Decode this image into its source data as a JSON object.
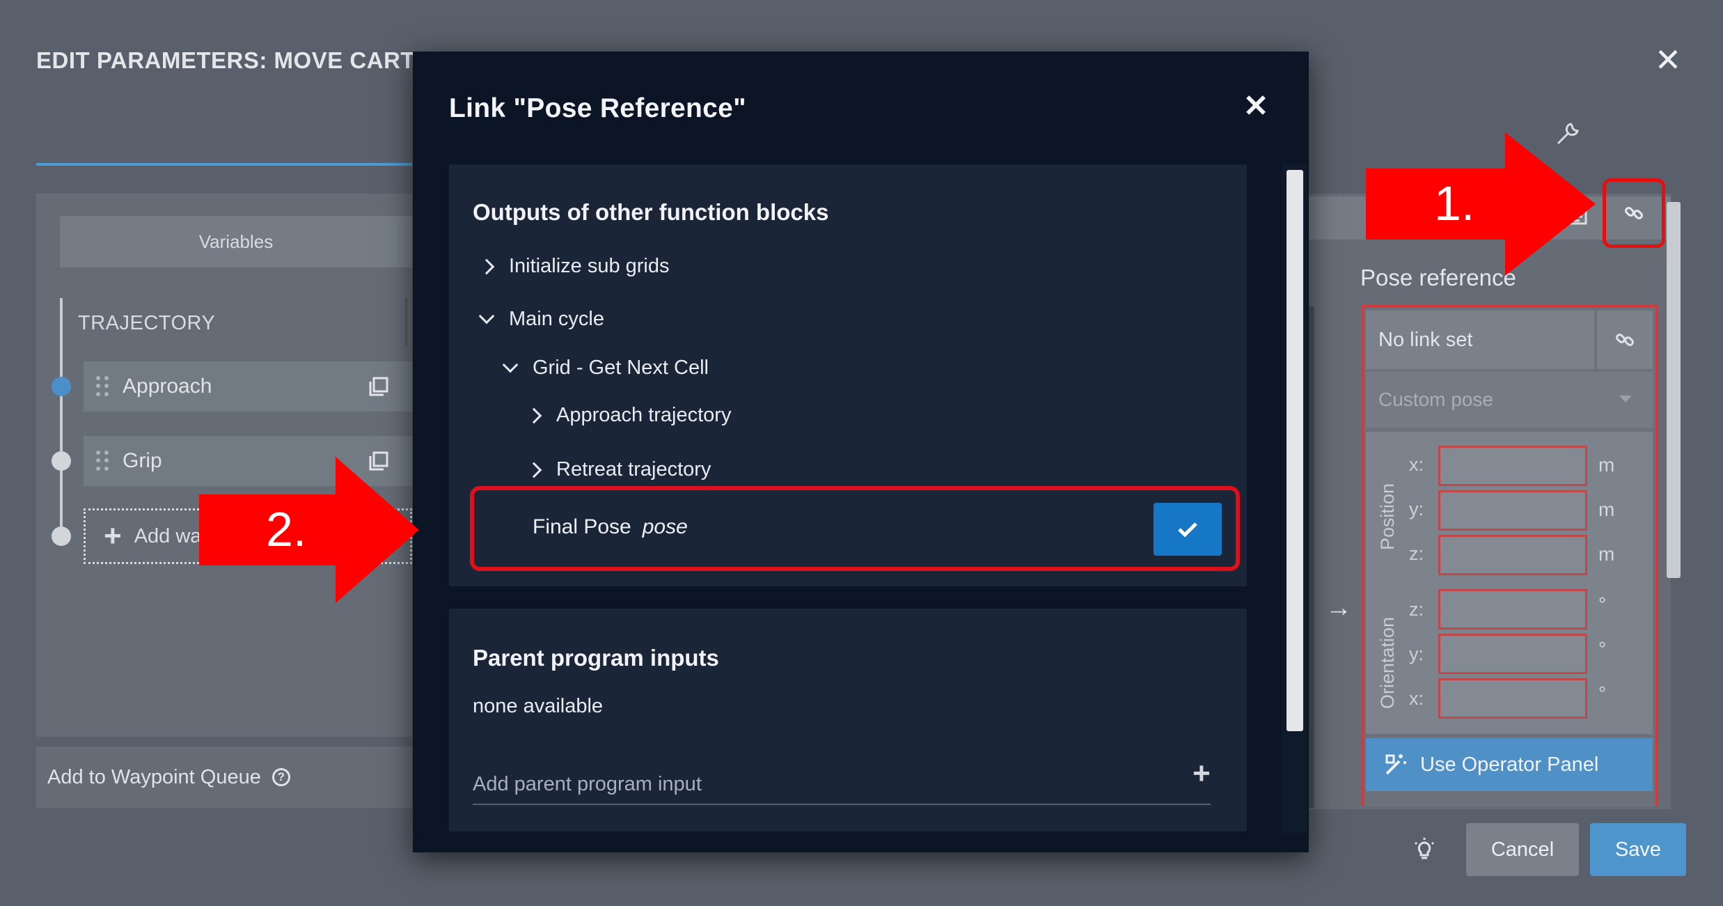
{
  "background": {
    "title": "EDIT PARAMETERS: MOVE CARTE",
    "variables_tab": "Variables",
    "trajectory_label": "TRAJECTORY",
    "waypoints": [
      {
        "label": "Approach"
      },
      {
        "label": "Grip"
      }
    ],
    "add_waypoint_label": "Add wa",
    "queue_label": "Add to Waypoint Queue",
    "pose_reference_label": "Pose reference",
    "no_link_label": "No link set",
    "custom_pose_placeholder": "Custom pose",
    "position_label": "Position",
    "orientation_label": "Orientation",
    "position_axes": [
      "x:",
      "y:",
      "z:"
    ],
    "position_units": [
      "m",
      "m",
      "m"
    ],
    "orientation_axes": [
      "z:",
      "y:",
      "x:"
    ],
    "orientation_units": [
      "°",
      "°",
      "°"
    ],
    "operator_panel_label": "Use Operator Panel",
    "cancel_label": "Cancel",
    "save_label": "Save"
  },
  "modal": {
    "title": "Link \"Pose Reference\"",
    "outputs_heading": "Outputs of other function blocks",
    "tree": [
      {
        "label": "Initialize sub grids",
        "expanded": false
      },
      {
        "label": "Main cycle",
        "expanded": true
      },
      {
        "label": "Grid - Get Next Cell",
        "expanded": true
      },
      {
        "label": "Approach trajectory",
        "expanded": false
      },
      {
        "label": "Retreat trajectory",
        "expanded": false
      }
    ],
    "final_pose_label": "Final Pose",
    "final_pose_type": "pose",
    "parent_heading": "Parent program inputs",
    "none_available": "none available",
    "add_parent_placeholder": "Add parent program input"
  },
  "annotations": {
    "step1": "1.",
    "step2": "2.",
    "color": "#ff0000"
  },
  "colors": {
    "accent": "#1677c6",
    "highlight": "#e0101a",
    "modal_bg": "#0b1525"
  }
}
